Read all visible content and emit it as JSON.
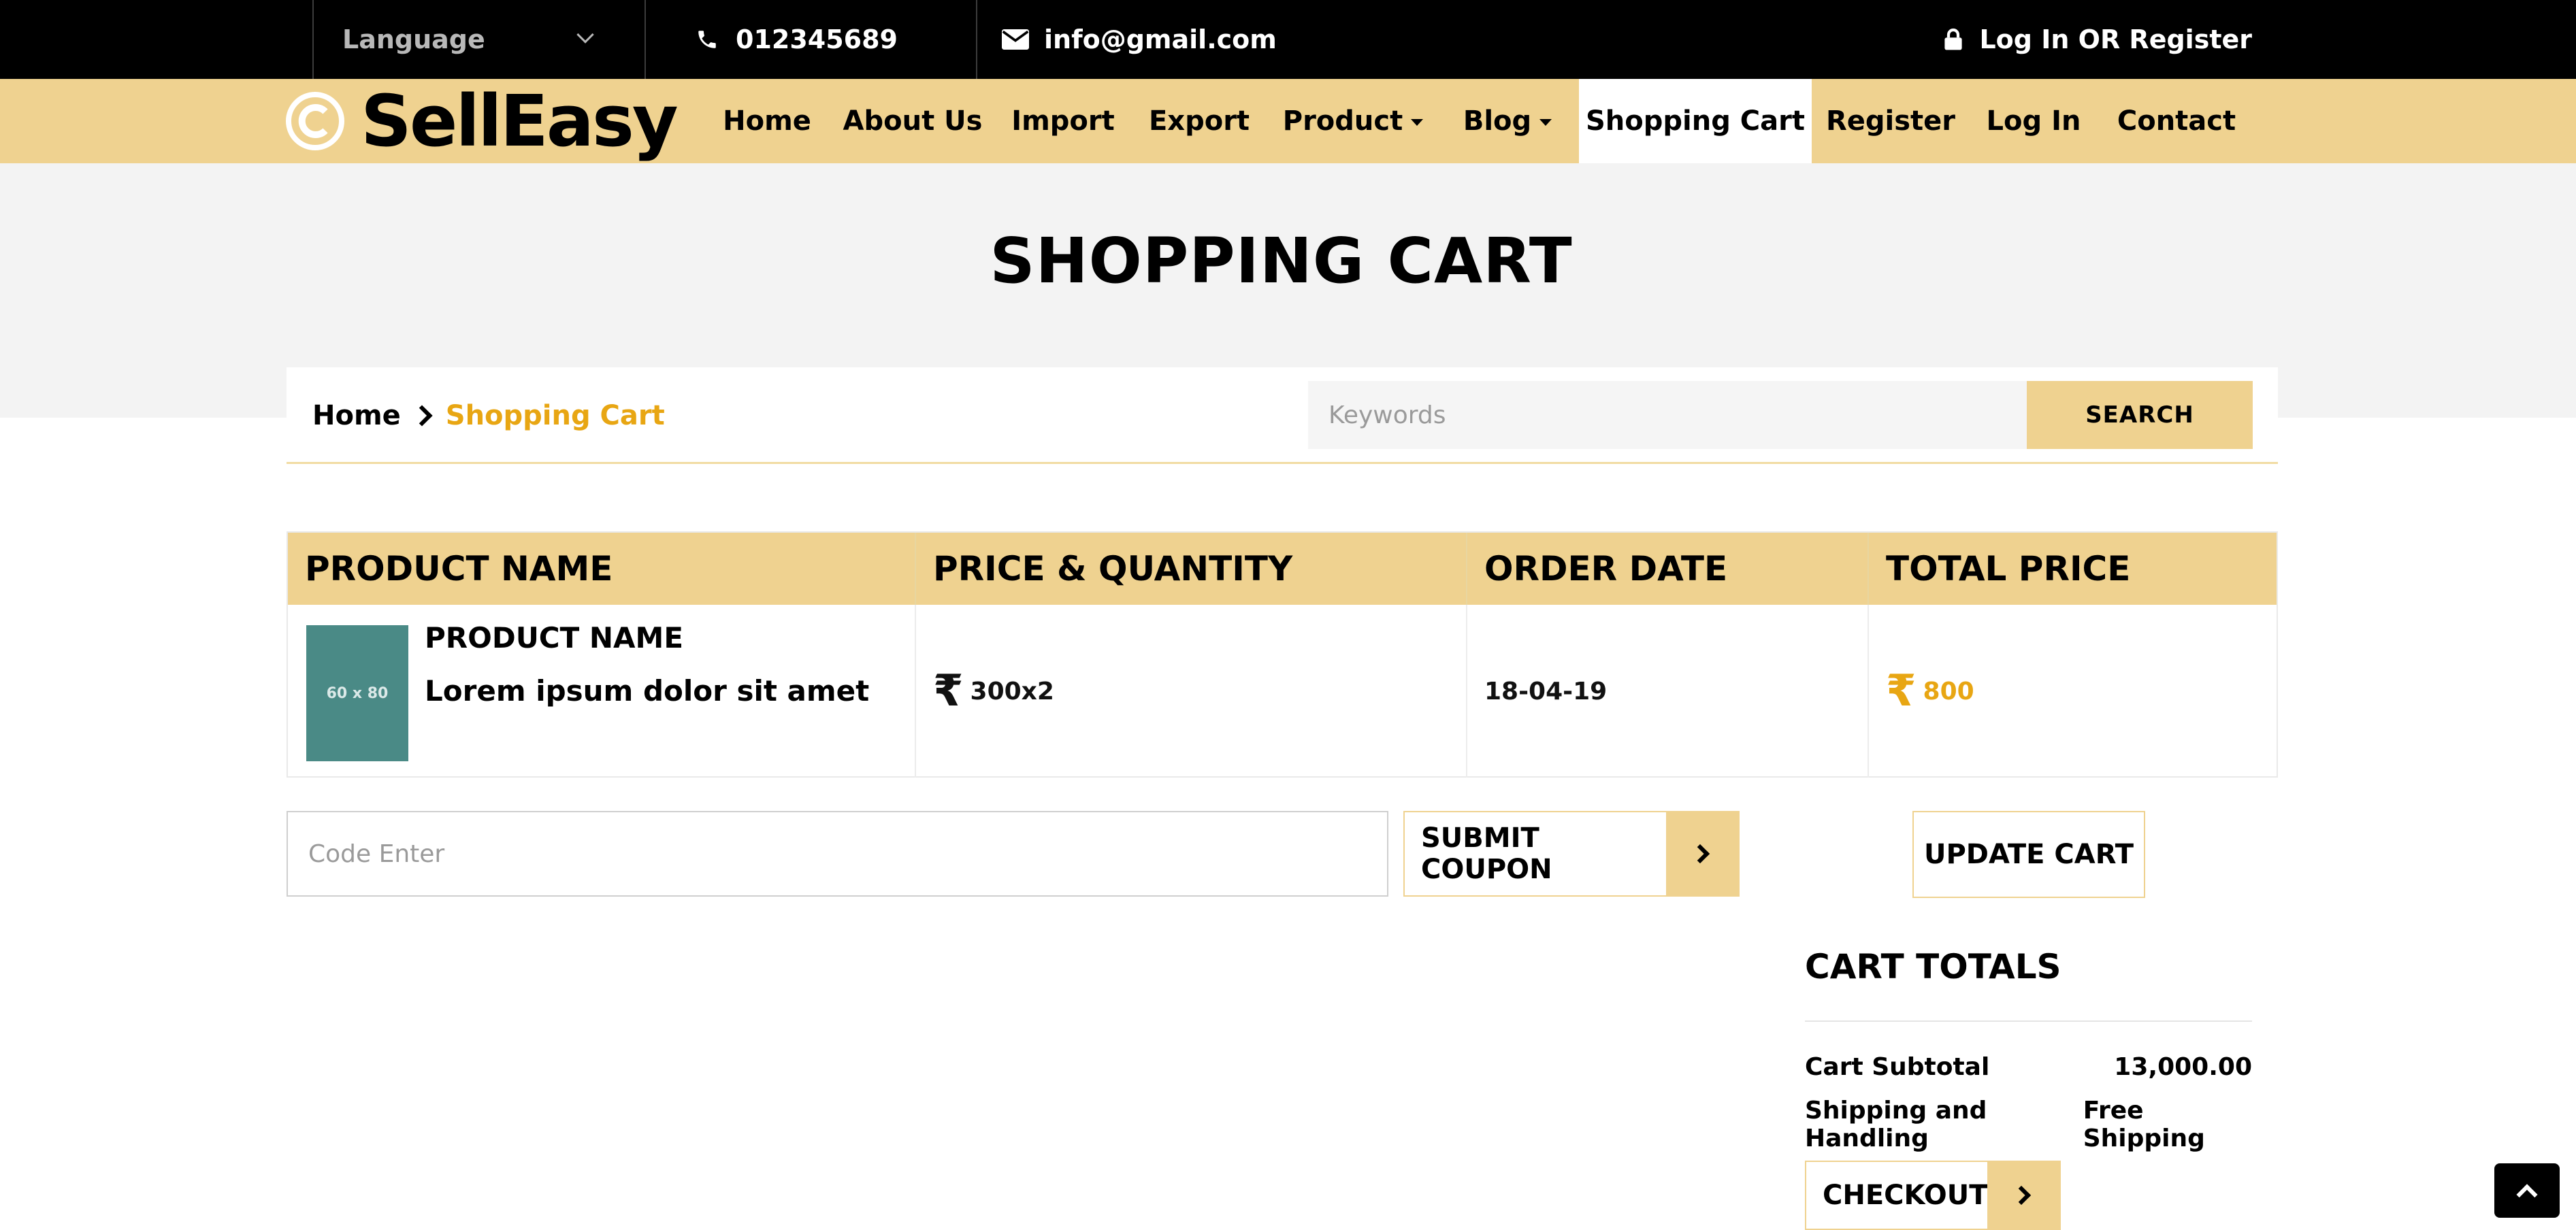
{
  "topbar": {
    "language_label": "Language",
    "phone": "012345689",
    "email": "info@gmail.com",
    "login_register": "Log In OR Register",
    "icons": [
      "chevron-down-icon",
      "phone-icon",
      "envelope-icon",
      "lock-icon"
    ]
  },
  "brand": {
    "logo_text": "SellEasy",
    "accent_color": "#efd290",
    "highlight_color": "#e8a613"
  },
  "nav": {
    "items": [
      {
        "label": "Home"
      },
      {
        "label": "About Us"
      },
      {
        "label": "Import"
      },
      {
        "label": "Export"
      },
      {
        "label": "Product",
        "dropdown": true
      },
      {
        "label": "Blog",
        "dropdown": true
      },
      {
        "label": "Shopping Cart",
        "active": true
      },
      {
        "label": "Register"
      },
      {
        "label": "Log In"
      },
      {
        "label": "Contact"
      }
    ]
  },
  "hero": {
    "title": "SHOPPING CART"
  },
  "breadcrumb": {
    "home": "Home",
    "current": "Shopping Cart"
  },
  "search": {
    "placeholder": "Keywords",
    "value": "",
    "button_label": "SEARCH"
  },
  "cart_table": {
    "headers": [
      "PRODUCT NAME",
      "PRICE & QUANTITY",
      "ORDER DATE",
      "TOTAL PRICE"
    ],
    "rows": [
      {
        "thumbnail_label": "60 x 80",
        "product_name": "PRODUCT NAME",
        "description": "Lorem ipsum dolor sit amet",
        "currency_symbol": "₹",
        "price_quantity": "300x2",
        "order_date": "18-04-19",
        "total_price": "800"
      }
    ]
  },
  "coupon": {
    "placeholder": "Code Enter",
    "value": "",
    "submit_label": "SUBMIT COUPON",
    "update_label": "UPDATE CART"
  },
  "totals": {
    "title": "CART TOTALS",
    "subtotal_label": "Cart Subtotal",
    "subtotal_value": "13,000.00",
    "shipping_label": "Shipping and Handling",
    "shipping_value": "Free Shipping",
    "checkout_label": "CHECKOUT"
  }
}
